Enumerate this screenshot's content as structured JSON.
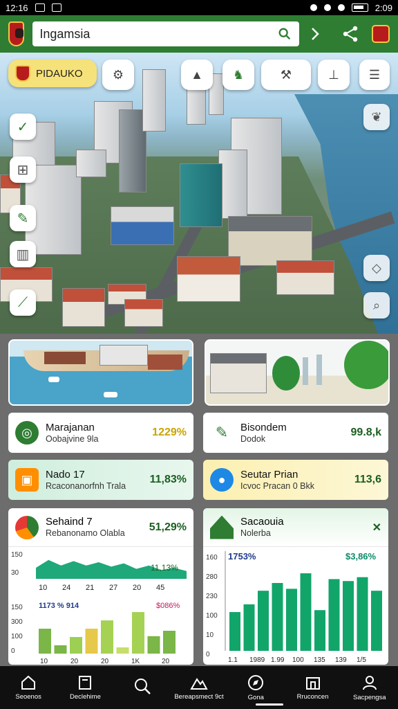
{
  "status_bar": {
    "time": "12:16",
    "right_time": "2:09"
  },
  "app_bar": {
    "search_value": "Ingamsia",
    "icons": [
      "search-icon",
      "share-icon",
      "flag-icon"
    ]
  },
  "map": {
    "primary_chip_label": "PIDAUKO",
    "top_chip_icons": [
      "gear-icon",
      "arrow-icon",
      "walker-icon",
      "tools-icon",
      "pin-icon",
      "document-icon"
    ],
    "side_buttons": [
      "check-icon",
      "bag-icon",
      "edit-icon",
      "trash-icon",
      "slash-icon"
    ],
    "right_buttons": [
      "leaf-icon",
      "tag-icon",
      "zoom-icon"
    ]
  },
  "stats": [
    {
      "title": "Marajanan",
      "subtitle": "Oobajvine 9la",
      "value": "1229%",
      "value_color": "#c9a400",
      "icon_color": "#2e7d32",
      "card_bg": "#ffffff"
    },
    {
      "title": "Bisondem",
      "subtitle": "Dodok",
      "value": "99.8,k",
      "value_color": "#1b5e20",
      "icon_color": "#2e7d32",
      "card_bg": "#ffffff"
    },
    {
      "title": "Nado 17",
      "subtitle": "Rcaconanorfnh Trala",
      "value": "11,83%",
      "value_color": "#1b5e20",
      "icon_color": "#ff8f00",
      "card_bg": "#cfeedd"
    },
    {
      "title": "Seutar Prian",
      "subtitle": "Icvoc Pracan 0 Bkk",
      "value": "113,6",
      "value_color": "#1b5e20",
      "icon_color": "#1e88e5",
      "card_bg": "#fbf0b0"
    }
  ],
  "left_chart": {
    "title": "Sehaind 7",
    "subtitle": "Rebanonamo Olabla",
    "value": "51,29%",
    "value_color": "#1b5e20",
    "area_annotation": "11,13%",
    "area_y_ticks": [
      "150",
      "30"
    ],
    "area_x_labels": [
      "10",
      "24",
      "21",
      "27",
      "20",
      "45"
    ],
    "bar_header_left": "1173 % 914",
    "bar_header_right": "$086%",
    "bar_y_ticks": [
      "150",
      "300",
      "100",
      "0"
    ],
    "bar_x_labels": [
      "10",
      "20",
      "20",
      "1K",
      "20"
    ]
  },
  "right_chart": {
    "title": "Sacaouia",
    "subtitle": "Nolerba",
    "value_icon": "close-icon",
    "header_left": "1753%",
    "header_right": "$3,86%",
    "y_ticks": [
      "160",
      "280",
      "230",
      "100",
      "10",
      "0"
    ],
    "x_labels": [
      "1.1",
      "1989",
      "1.99",
      "100",
      "135",
      "139",
      "1/5"
    ]
  },
  "chart_data": [
    {
      "type": "area",
      "title": "Sehaind 7",
      "x": [
        "10",
        "24",
        "21",
        "27",
        "20",
        "45"
      ],
      "series": [
        {
          "values": [
            20,
            34,
            24,
            32,
            24,
            30,
            22,
            28,
            18,
            24,
            16,
            20,
            14
          ]
        }
      ],
      "ylim": [
        0,
        50
      ]
    },
    {
      "type": "bar",
      "categories": [
        "10",
        "20",
        "20",
        "1K",
        "20"
      ],
      "values": [
        60,
        20,
        40,
        60,
        80,
        15,
        100,
        42,
        55
      ],
      "colors": [
        "#7ab648",
        "#7ab648",
        "#9ccf52",
        "#e6c84a",
        "#a6d253",
        "#c7de6a",
        "#a6d253",
        "#7ab648",
        "#7ab648"
      ],
      "ylim": [
        0,
        100
      ]
    },
    {
      "type": "bar",
      "title": "Sacaouia",
      "categories": [
        "1.1",
        "1989",
        "1.99",
        "100",
        "135",
        "139",
        "1/5"
      ],
      "values": [
        40,
        48,
        62,
        70,
        64,
        80,
        42,
        74,
        72,
        76,
        62
      ],
      "color": "#12a56a",
      "ylim": [
        0,
        100
      ]
    }
  ],
  "bottom_nav": [
    {
      "label": "Seoenos"
    },
    {
      "label": "Declehime"
    },
    {
      "label": ""
    },
    {
      "label": "Bereapsmect 9ct"
    },
    {
      "label": "Gona"
    },
    {
      "label": "Rruconcen"
    },
    {
      "label": "Sacpengsa"
    }
  ]
}
